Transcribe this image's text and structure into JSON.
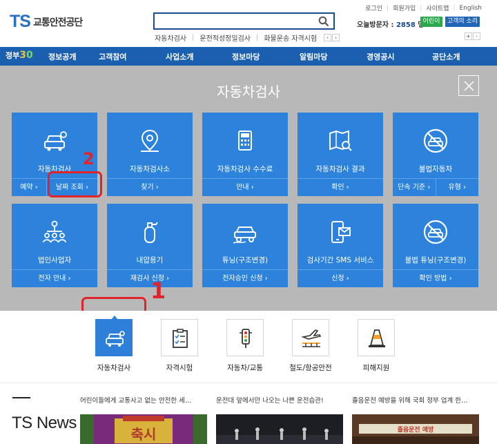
{
  "header": {
    "logo_mark": "TS",
    "logo_name": "교통안전공단",
    "search_placeholder": "",
    "keywords": [
      "자동차검사",
      "운전적성정밀검사",
      "화물운송 자격시험"
    ],
    "kw_prev": "‹",
    "kw_next": "›",
    "top_links": [
      "로그인",
      "회원가입",
      "사이트맵",
      "English"
    ],
    "visitor_label": "오늘방문자 :",
    "visitor_count": "2858",
    "visitor_unit": "명",
    "kids_button": "어린이",
    "voice_button": "고객의 소리",
    "font_plus": "+",
    "font_minus": "-"
  },
  "nav": {
    "gov_prefix": "정부",
    "gov_three": "3",
    "gov_zero": "0",
    "items": [
      "정보공개",
      "고객참여",
      "사업소개",
      "정보마당",
      "알림마당",
      "경영공시",
      "공단소개"
    ]
  },
  "panel": {
    "title": "자동차검사",
    "close_glyph": "×",
    "tiles": [
      {
        "title": "자동차검사",
        "links": [
          "예약 ›",
          "날짜 조회 ›"
        ]
      },
      {
        "title": "자동차검사소",
        "links": [
          "찾기 ›"
        ]
      },
      {
        "title": "자동차검사 수수료",
        "links": [
          "안내 ›"
        ]
      },
      {
        "title": "자동차검사 결과",
        "links": [
          "확인 ›"
        ]
      },
      {
        "title": "불법자동차",
        "links": [
          "단속 기준 ›",
          "유형 ›"
        ]
      },
      {
        "title": "법인사업자",
        "links": [
          "전자 안내 ›"
        ]
      },
      {
        "title": "내압용기",
        "links": [
          "재검사 신청 ›"
        ]
      },
      {
        "title": "튜닝(구조변경)",
        "links": [
          "전자승인 신청 ›"
        ]
      },
      {
        "title": "검사기간 SMS 서비스",
        "links": [
          "신청 ›"
        ]
      },
      {
        "title": "불법 튜닝(구조변경)",
        "links": [
          "확인 방법 ›"
        ]
      }
    ]
  },
  "annotations": {
    "one": "1",
    "two": "2"
  },
  "categories": [
    {
      "label": "자동차검사",
      "icon": "car-inspection-icon",
      "active": true
    },
    {
      "label": "자격시험",
      "icon": "checklist-icon",
      "active": false
    },
    {
      "label": "자동차/교통",
      "icon": "traffic-light-icon",
      "active": false
    },
    {
      "label": "철도/항공안전",
      "icon": "plane-rail-icon",
      "active": false
    },
    {
      "label": "피해지원",
      "icon": "traffic-cone-icon",
      "active": false
    }
  ],
  "news": {
    "title": "TS News",
    "items": [
      {
        "headline": "어린이들에게 교통사고 없는 안전한 세…",
        "image_text": "축시"
      },
      {
        "headline": "운전대 앞에서만 나오는 나쁜 운전습관!",
        "image_text": ""
      },
      {
        "headline": "졸음운전 예방을 위해 국회 정부 업계 한…",
        "image_text": "졸음운전 예방"
      }
    ]
  },
  "colors": {
    "brand_blue": "#1b5fb0",
    "tile_blue": "#2d83dc",
    "panel_gray": "#b8b8b8",
    "annotation_red": "#e0242a",
    "logo_orange": "#f2a22a"
  }
}
